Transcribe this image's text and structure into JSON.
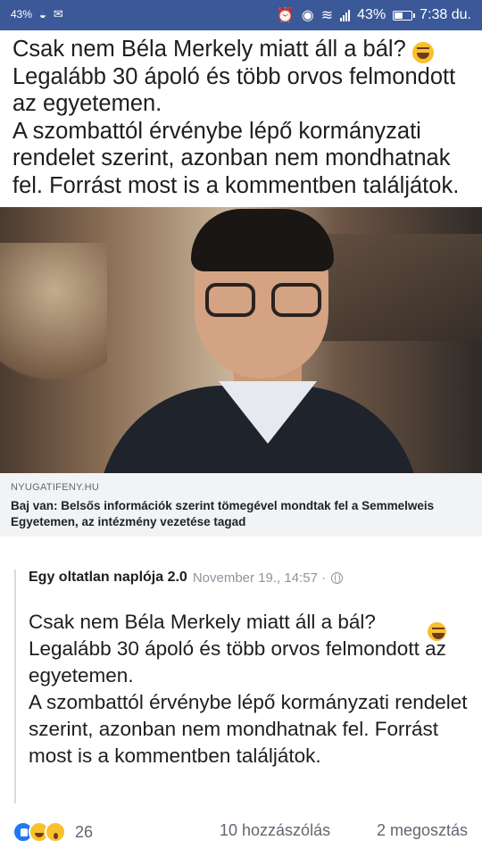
{
  "status_bar": {
    "left_percent": "43",
    "battery": "43%",
    "time": "7:38 du."
  },
  "post": {
    "text": "Csak nem Béla Merkely miatt áll a bál?\nLegalább 30 ápoló és több orvos felmondott az egyetemen.\nA szombattól érvénybe lépő kormányzati rendelet szerint, azonban nem mondhatnak fel. Forrást most is a kommentben találjátok.",
    "emoji": "rolling-on-floor-laughing"
  },
  "link_preview": {
    "domain": "NYUGATIFENY.HU",
    "headline": "Baj van: Belsős információk szerint tömegével mondtak fel a Semmelweis Egyetemen, az intézmény vezetése tagad"
  },
  "shared_post": {
    "author": "Egy oltatlan naplója 2.0",
    "date": "November 19., 14:57 ·",
    "text": "Csak nem Béla Merkely miatt áll a bál?\nLegalább 30 ápoló és több orvos felmondott az egyetemen.\nA szombattól érvénybe lépő kormányzati rendelet szerint, azonban nem mondhatnak fel. Forrást most is a kommentben találjátok."
  },
  "footer": {
    "reaction_count": "26",
    "comments": "10 hozzászólás",
    "shares": "2 megosztás"
  },
  "colors": {
    "status_bar": "#3b5998",
    "like": "#2078f4",
    "emoji_yellow": "#f7c02d"
  }
}
